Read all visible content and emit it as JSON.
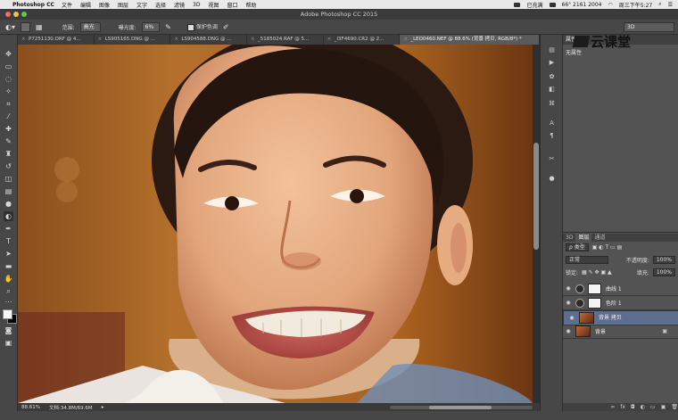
{
  "menubar": {
    "app_name": "Photoshop CC",
    "items": [
      "文件",
      "编辑",
      "图像",
      "图层",
      "文字",
      "选择",
      "滤镜",
      "3D",
      "视图",
      "窗口",
      "帮助"
    ],
    "status_text": "已充满",
    "phone": "66° 2161 2004",
    "clock": "周三下午5:27"
  },
  "window": {
    "title": "Adobe Photoshop CC 2015"
  },
  "options_bar": {
    "range_label": "范围:",
    "range_value": "高光",
    "exposure_label": "曝光度:",
    "exposure_value": "6%",
    "protect_tones_label": "保护色调",
    "workspace": "3D"
  },
  "tabs": [
    {
      "label": "P7251130.ORF @ 4...",
      "active": false
    },
    {
      "label": "LS905165.DNG @ ...",
      "active": false
    },
    {
      "label": "LS904588.DNG @ ...",
      "active": false
    },
    {
      "label": "_5185024.RAF @ 5...",
      "active": false
    },
    {
      "label": "_I3F4690.CR2 @ 2...",
      "active": false
    },
    {
      "label": "_LEO0460.NEF @ 88.6% (背景 拷贝, RGB/8*) *",
      "active": true
    }
  ],
  "status": {
    "zoom": "88.61%",
    "doc_size": "文档:34.8M/69.6M"
  },
  "properties": {
    "header": "属性",
    "subheader": "无属性"
  },
  "watermark": {
    "text": "云课堂"
  },
  "layers_panel": {
    "tabs": [
      "3D",
      "图层",
      "通道"
    ],
    "kind_label": "ρ 类型",
    "blend_mode": "正常",
    "opacity_label": "不透明度:",
    "opacity_value": "100%",
    "lock_label": "锁定:",
    "fill_label": "填充:",
    "fill_value": "100%",
    "layers": [
      {
        "name": "曲线 1",
        "kind": "adjustment",
        "selected": false
      },
      {
        "name": "色阶 1",
        "kind": "adjustment",
        "selected": false
      },
      {
        "name": "背景 拷贝",
        "kind": "image",
        "selected": true
      },
      {
        "name": "背景",
        "kind": "image",
        "selected": false,
        "locked": true
      }
    ]
  },
  "colors": {
    "menubar_bg": "#e9e9e9",
    "app_bg": "#535353",
    "panel_dark": "#404040",
    "selected_layer": "#5d6e8e",
    "photo_background": "#8a4a18"
  }
}
